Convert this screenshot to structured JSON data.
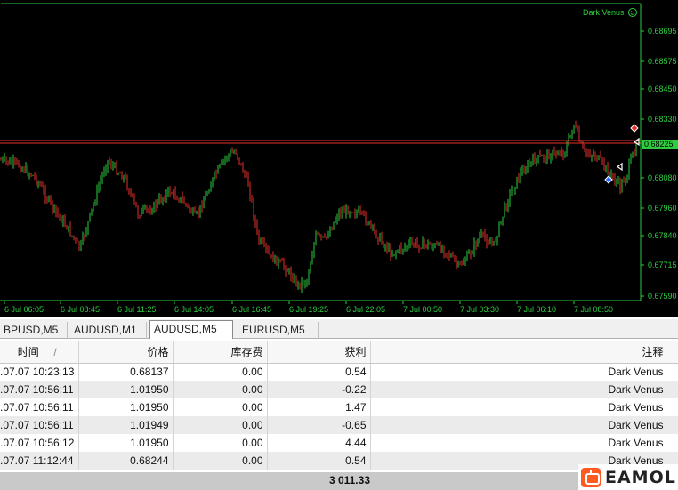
{
  "chart": {
    "ea_name": "Dark Venus",
    "smiley_icon": "smiley-face-icon",
    "current_price": "0.68225",
    "price_labels": [
      "0.68695",
      "0.68575",
      "0.68450",
      "0.68330",
      "0.68080",
      "0.67960",
      "0.67840",
      "0.67715",
      "0.67590"
    ],
    "time_labels": [
      "6 Jul 06:05",
      "6 Jul 08:45",
      "6 Jul 11:25",
      "6 Jul 14:05",
      "6 Jul 16:45",
      "6 Jul 19:25",
      "6 Jul 22:05",
      "7 Jul 00:50",
      "7 Jul 03:30",
      "7 Jul 06:10",
      "7 Jul 08:50"
    ],
    "colors": {
      "background": "#000000",
      "bull": "#2ecc40",
      "bear": "#e8302a",
      "level_line": "#e8302a",
      "price_tag": "#2ecc40"
    }
  },
  "tabs": [
    {
      "label": "BPUSD,M5",
      "active": false
    },
    {
      "label": "AUDUSD,M1",
      "active": false
    },
    {
      "label": "AUDUSD,M5",
      "active": true
    },
    {
      "label": "EURUSD,M5",
      "active": false
    }
  ],
  "table": {
    "headers": {
      "time": "时间",
      "sort_marker": "/",
      "price": "价格",
      "swap": "库存费",
      "profit": "获利",
      "comment": "注释"
    },
    "rows": [
      {
        "time": ".07.07 10:23:13",
        "price": "0.68137",
        "swap": "0.00",
        "profit": "0.54",
        "comment": "Dark Venus"
      },
      {
        "time": ".07.07 10:56:11",
        "price": "1.01950",
        "swap": "0.00",
        "profit": "-0.22",
        "comment": "Dark Venus"
      },
      {
        "time": ".07.07 10:56:11",
        "price": "1.01950",
        "swap": "0.00",
        "profit": "1.47",
        "comment": "Dark Venus"
      },
      {
        "time": ".07.07 10:56:11",
        "price": "1.01949",
        "swap": "0.00",
        "profit": "-0.65",
        "comment": "Dark Venus"
      },
      {
        "time": ".07.07 10:56:12",
        "price": "1.01950",
        "swap": "0.00",
        "profit": "4.44",
        "comment": "Dark Venus"
      },
      {
        "time": ".07.07 11:12:44",
        "price": "0.68244",
        "swap": "0.00",
        "profit": "0.54",
        "comment": "Dark Venus"
      }
    ]
  },
  "footer": {
    "total": "3 011.33"
  },
  "watermark": {
    "text": "EAMOL",
    "icon": "robot-logo-icon"
  }
}
